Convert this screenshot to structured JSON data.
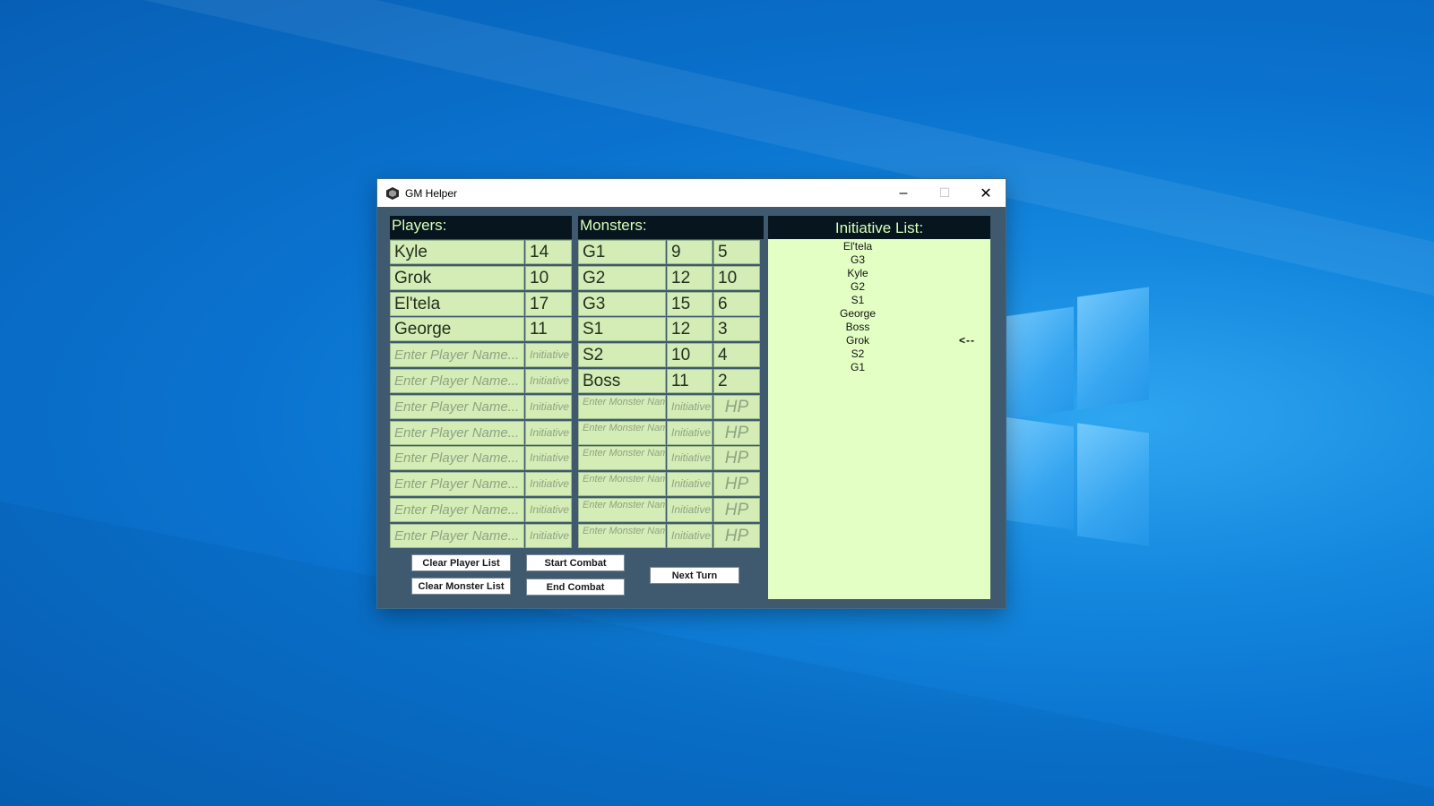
{
  "window": {
    "title": "GM Helper",
    "controls": {
      "minimize": "–",
      "maximize": "☐",
      "close": "✕"
    }
  },
  "players": {
    "header": "Players:",
    "name_placeholder": "Enter Player Name...",
    "initiative_placeholder": "Initiative",
    "rows": [
      {
        "name": "Kyle",
        "initiative": "14"
      },
      {
        "name": "Grok",
        "initiative": "10"
      },
      {
        "name": "El'tela",
        "initiative": "17"
      },
      {
        "name": "George",
        "initiative": "11"
      },
      {
        "name": "",
        "initiative": ""
      },
      {
        "name": "",
        "initiative": ""
      },
      {
        "name": "",
        "initiative": ""
      },
      {
        "name": "",
        "initiative": ""
      },
      {
        "name": "",
        "initiative": ""
      },
      {
        "name": "",
        "initiative": ""
      },
      {
        "name": "",
        "initiative": ""
      },
      {
        "name": "",
        "initiative": ""
      }
    ]
  },
  "monsters": {
    "header": "Monsters:",
    "name_placeholder": "Enter Monster Name...",
    "initiative_placeholder": "Initiative",
    "hp_placeholder": "HP",
    "rows": [
      {
        "name": "G1",
        "initiative": "9",
        "hp": "5"
      },
      {
        "name": "G2",
        "initiative": "12",
        "hp": "10"
      },
      {
        "name": "G3",
        "initiative": "15",
        "hp": "6"
      },
      {
        "name": "S1",
        "initiative": "12",
        "hp": "3"
      },
      {
        "name": "S2",
        "initiative": "10",
        "hp": "4"
      },
      {
        "name": "Boss",
        "initiative": "11",
        "hp": "2"
      },
      {
        "name": "",
        "initiative": "",
        "hp": ""
      },
      {
        "name": "",
        "initiative": "",
        "hp": ""
      },
      {
        "name": "",
        "initiative": "",
        "hp": ""
      },
      {
        "name": "",
        "initiative": "",
        "hp": ""
      },
      {
        "name": "",
        "initiative": "",
        "hp": ""
      },
      {
        "name": "",
        "initiative": "",
        "hp": ""
      }
    ]
  },
  "buttons": {
    "clear_players": "Clear Player List",
    "clear_monsters": "Clear Monster List",
    "start_combat": "Start Combat",
    "end_combat": "End Combat",
    "next_turn": "Next Turn"
  },
  "initiative": {
    "header": "Initiative List:",
    "order": [
      "El'tela",
      "G3",
      "Kyle",
      "G2",
      "S1",
      "George",
      "Boss",
      "Grok",
      "S2",
      "G1"
    ],
    "current_marker": "<--",
    "current_index": 7
  },
  "colors": {
    "panel_header_bg": "#07161e",
    "panel_header_text": "#d9ffb8",
    "cell_bg": "#d4ecb6",
    "initiative_bg": "#e3ffc3",
    "window_bg": "#3f5a6e"
  }
}
